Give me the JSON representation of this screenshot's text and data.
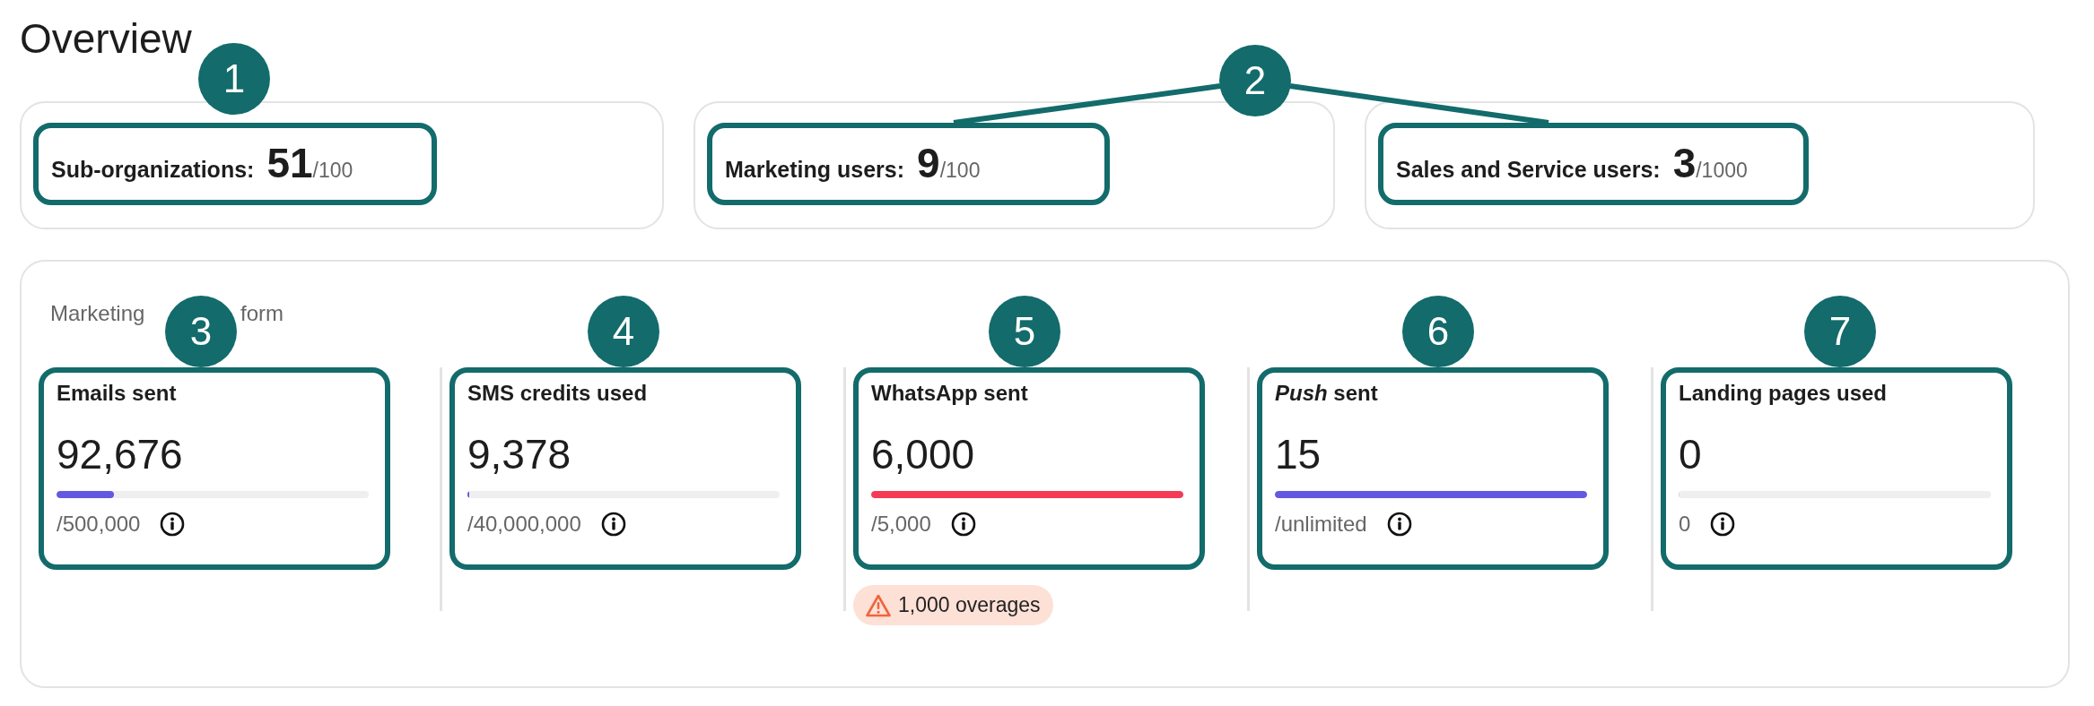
{
  "title": "Overview",
  "summary": [
    {
      "label": "Sub-organizations:",
      "value": "51",
      "limit": "/100"
    },
    {
      "label": "Marketing users:",
      "value": "9",
      "limit": "/100"
    },
    {
      "label": "Sales and Service users:",
      "value": "3",
      "limit": "/1000"
    }
  ],
  "summary_callouts": [
    {
      "label": "1"
    },
    {
      "label": "2"
    }
  ],
  "platform": {
    "label_parts": [
      "Marketing",
      "form"
    ],
    "metrics": [
      {
        "title": "Emails sent",
        "value": "92,676",
        "level": 0.185,
        "color": "#6359e0",
        "limit": "/500,000",
        "callout": "3"
      },
      {
        "title": "SMS credits used",
        "value": "9,378",
        "level": 0.005,
        "color": "#6359e0",
        "limit": "/40,000,000",
        "callout": "4"
      },
      {
        "title": "WhatsApp sent",
        "value": "6,000",
        "level": 1,
        "color": "#f43b55",
        "limit": "/5,000",
        "callout": "5",
        "warning": "1,000 overages"
      },
      {
        "title": "*Push* sent",
        "value": "15",
        "level": 1,
        "color": "#6359e0",
        "limit": "/unlimited",
        "callout": "6"
      },
      {
        "title": "Landing pages used",
        "value": "0",
        "level": 0,
        "limit": "0",
        "callout": "7"
      }
    ]
  }
}
